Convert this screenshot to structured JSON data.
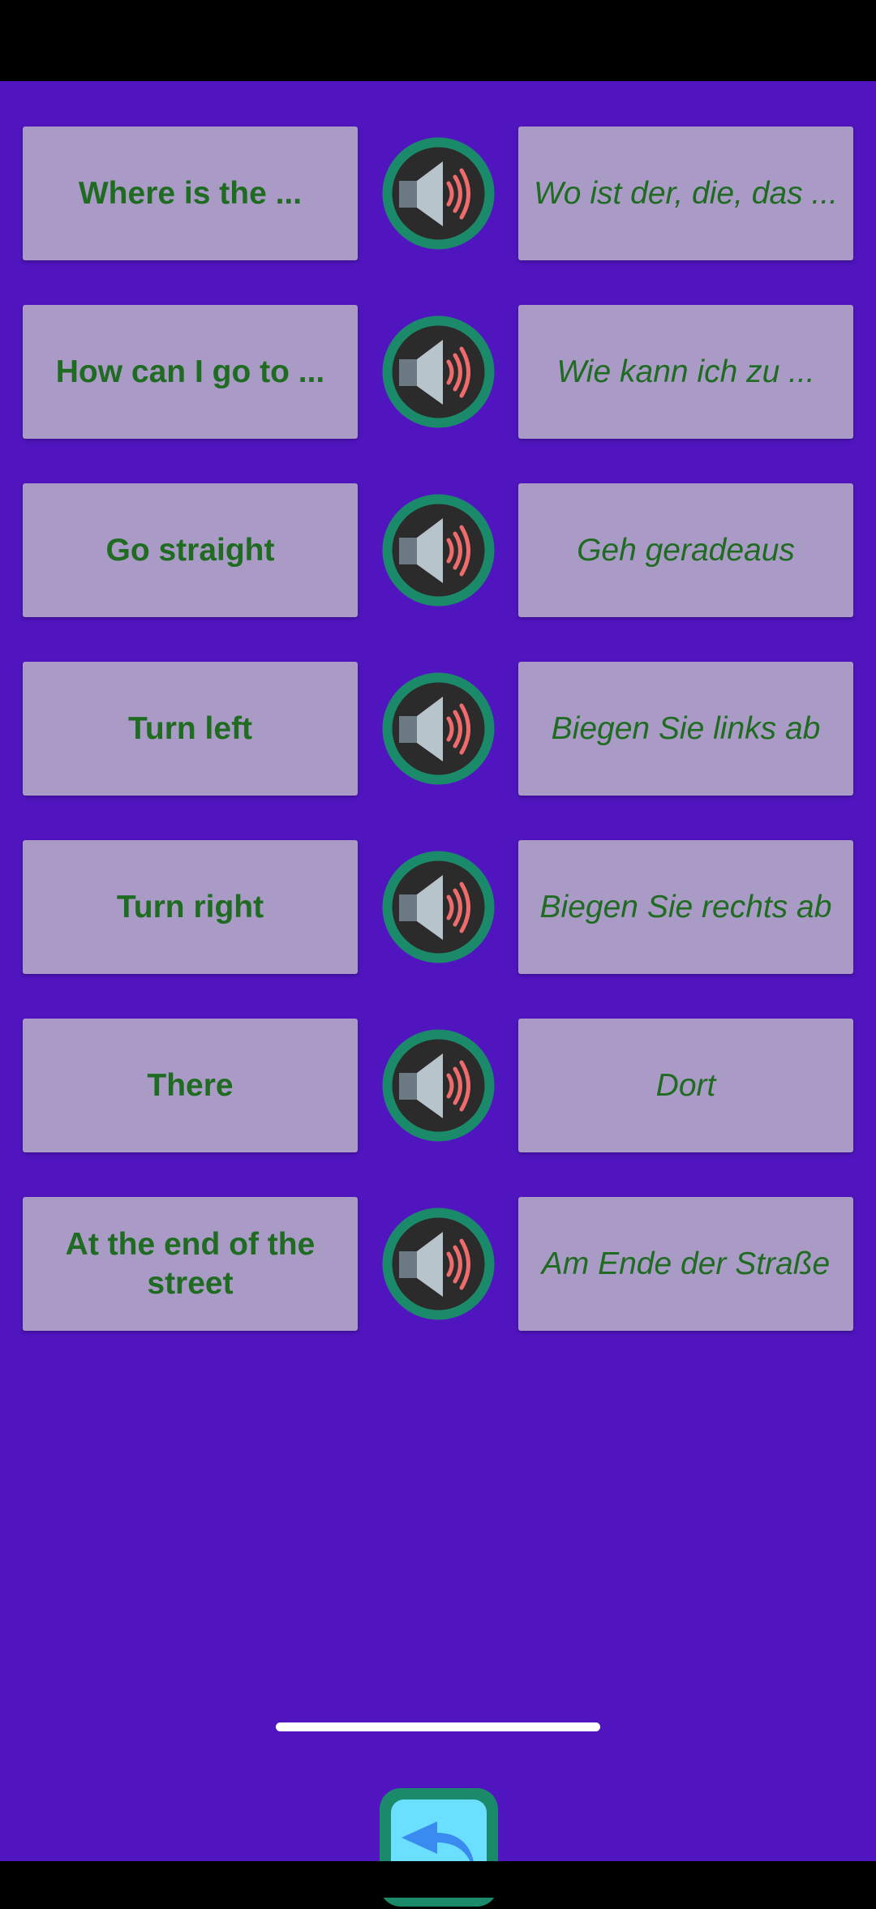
{
  "colors": {
    "background": "#5015BF",
    "card": "#AA9AC6",
    "text": "#1F6B22",
    "speaker_ring": "#1B8A6B",
    "speaker_fill": "#2B2B2B",
    "back_button_fill": "#6BDFFF",
    "back_arrow": "#3A8BF0"
  },
  "phrases": [
    {
      "english": "Where is the ...",
      "german": "Wo ist der, die, das ...",
      "icon": "speaker-icon"
    },
    {
      "english": "How can I go to ...",
      "german": "Wie kann ich zu ...",
      "icon": "speaker-icon"
    },
    {
      "english": "Go straight",
      "german": "Geh geradeaus",
      "icon": "speaker-icon"
    },
    {
      "english": "Turn left",
      "german": "Biegen Sie links ab",
      "icon": "speaker-icon"
    },
    {
      "english": "Turn right",
      "german": "Biegen Sie rechts ab",
      "icon": "speaker-icon"
    },
    {
      "english": "There",
      "german": "Dort",
      "icon": "speaker-icon"
    },
    {
      "english": "At the end of the street",
      "german": "Am Ende der Straße",
      "icon": "speaker-icon"
    }
  ],
  "back_button": {
    "icon": "back-arrow-icon"
  }
}
